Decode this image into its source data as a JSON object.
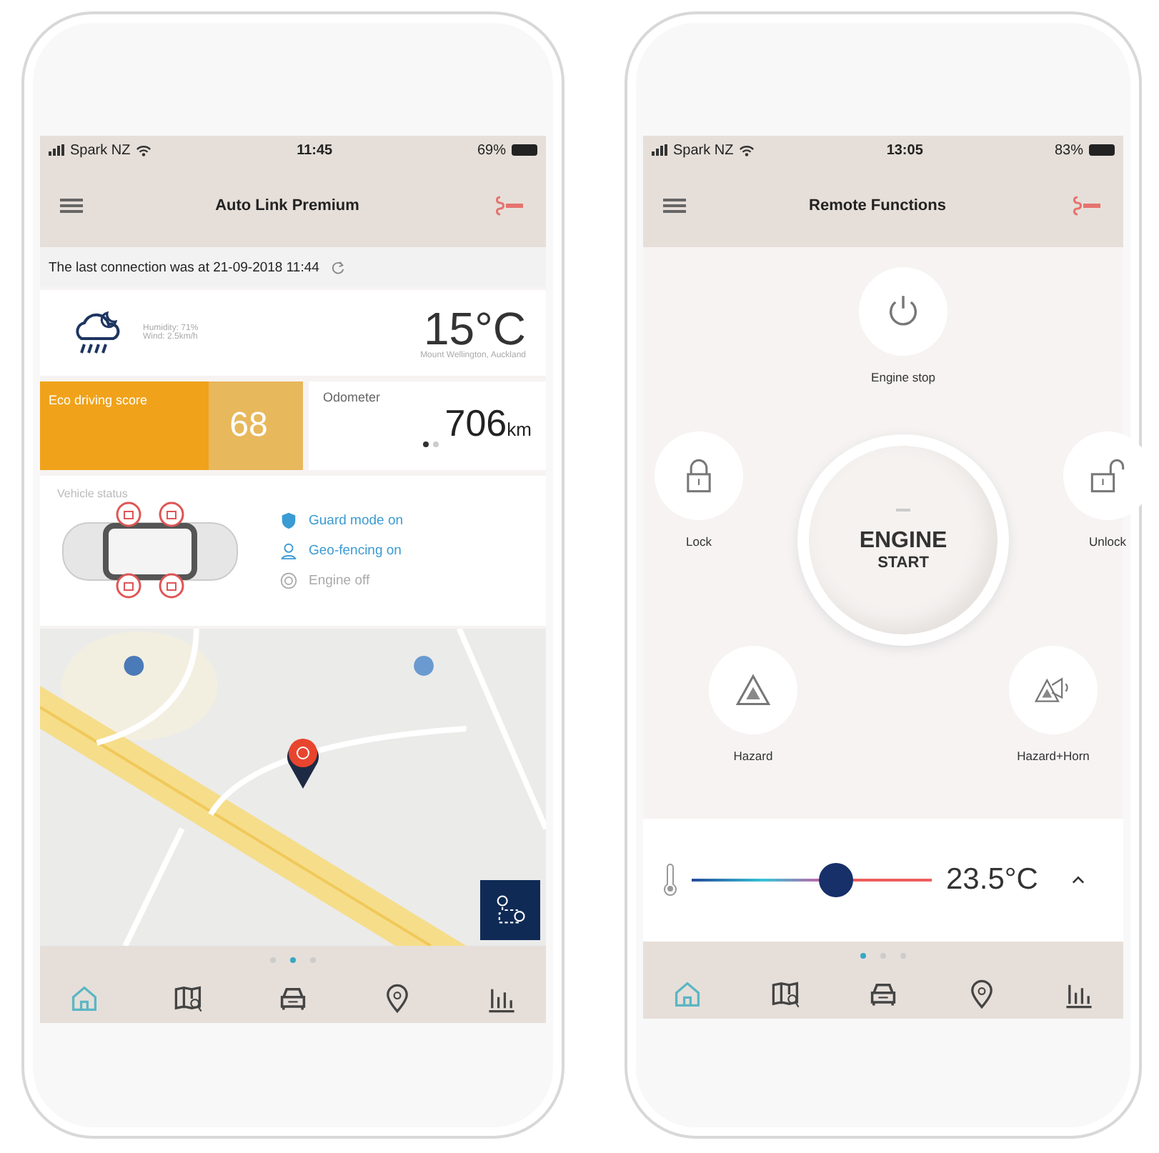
{
  "phones": [
    {
      "kind": "dashboard",
      "status_bar": {
        "carrier": "Spark NZ",
        "time": "11:45",
        "battery": "69%"
      },
      "header": {
        "title": "Auto Link Premium"
      },
      "last_connection": {
        "text": "The last connection was at 21-09-2018 11:44"
      },
      "weather": {
        "humidity": "Humidity: 71%",
        "wind": "Wind: 2.5km/h",
        "temperature": "15°C",
        "location": "Mount Wellington, Auckland"
      },
      "eco_score": {
        "label": "Eco driving score",
        "value": "68"
      },
      "odometer": {
        "label": "Odometer",
        "value": "706",
        "unit": "km",
        "pager": [
          {
            "selected": true
          },
          {
            "selected": false
          }
        ]
      },
      "vehicle_status": {
        "title": "Vehicle status",
        "items": [
          {
            "kind": "guard",
            "label": "Guard mode on",
            "on": true
          },
          {
            "kind": "geofence",
            "label": "Geo-fencing on",
            "on": true
          },
          {
            "kind": "engine",
            "label": "Engine off",
            "on": false
          }
        ]
      },
      "pager": [
        {
          "selected": false
        },
        {
          "selected": true
        },
        {
          "selected": false
        }
      ],
      "tab_bar": [
        {
          "kind": "home",
          "selected": true
        },
        {
          "kind": "map",
          "selected": false
        },
        {
          "kind": "car",
          "selected": false
        },
        {
          "kind": "pin",
          "selected": false
        },
        {
          "kind": "stats",
          "selected": false
        }
      ]
    },
    {
      "kind": "remote",
      "status_bar": {
        "carrier": "Spark NZ",
        "time": "13:05",
        "battery": "83%"
      },
      "header": {
        "title": "Remote Functions"
      },
      "buttons": [
        {
          "kind": "power",
          "label": "Engine stop"
        },
        {
          "kind": "lock",
          "label": "Lock"
        },
        {
          "kind": "unlock",
          "label": "Unlock"
        },
        {
          "kind": "hazard",
          "label": "Hazard"
        },
        {
          "kind": "hazard_horn",
          "label": "Hazard+Horn"
        }
      ],
      "engine_start": {
        "line1": "ENGINE",
        "line2": "START"
      },
      "climate": {
        "level": 0.6,
        "reading": "23.5°C"
      },
      "pager": [
        {
          "selected": true
        },
        {
          "selected": false
        },
        {
          "selected": false
        }
      ],
      "tab_bar": [
        {
          "kind": "home",
          "selected": true
        },
        {
          "kind": "map",
          "selected": false
        },
        {
          "kind": "car",
          "selected": false
        },
        {
          "kind": "pin",
          "selected": false
        },
        {
          "kind": "stats",
          "selected": false
        }
      ]
    }
  ]
}
